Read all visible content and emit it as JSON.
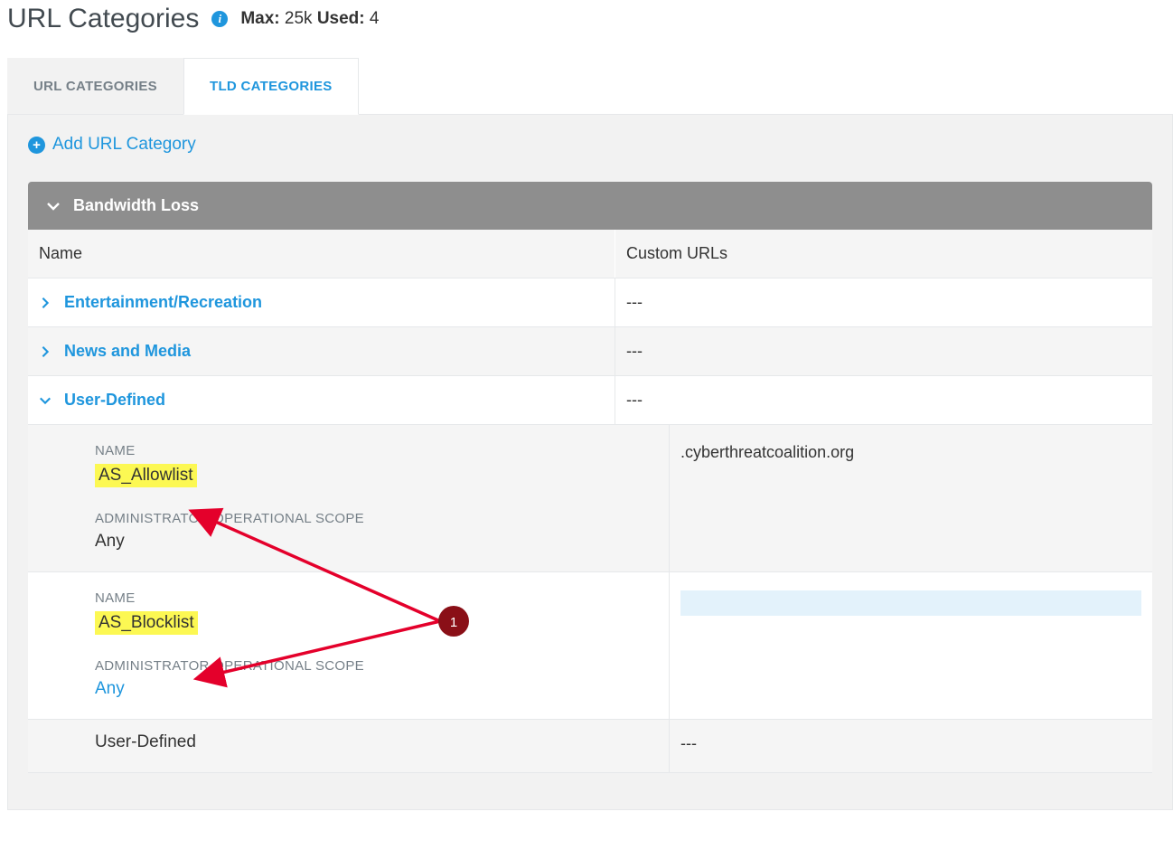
{
  "header": {
    "title": "URL Categories",
    "max_label": "Max:",
    "max_value": "25k",
    "used_label": "Used:",
    "used_value": "4"
  },
  "tabs": {
    "url": "URL CATEGORIES",
    "tld": "TLD CATEGORIES"
  },
  "actions": {
    "add": "Add URL Category"
  },
  "section": {
    "title": "Bandwidth Loss"
  },
  "columns": {
    "name": "Name",
    "custom": "Custom URLs"
  },
  "rows": {
    "r1": {
      "name": "Entertainment/Recreation",
      "custom": "---"
    },
    "r2": {
      "name": "News and Media",
      "custom": "---"
    },
    "r3": {
      "name": "User-Defined",
      "custom": "---"
    },
    "sub1": {
      "name_label": "NAME",
      "name_value": "AS_Allowlist",
      "scope_label": "ADMINISTRATOR OPERATIONAL SCOPE",
      "scope_value": "Any",
      "custom": ".cyberthreatcoalition.org"
    },
    "sub2": {
      "name_label": "NAME",
      "name_value": "AS_Blocklist",
      "scope_label": "ADMINISTRATOR OPERATIONAL SCOPE",
      "scope_value": "Any"
    },
    "r4": {
      "name": "User-Defined",
      "custom": "---"
    }
  },
  "annotation": {
    "badge": "1"
  }
}
